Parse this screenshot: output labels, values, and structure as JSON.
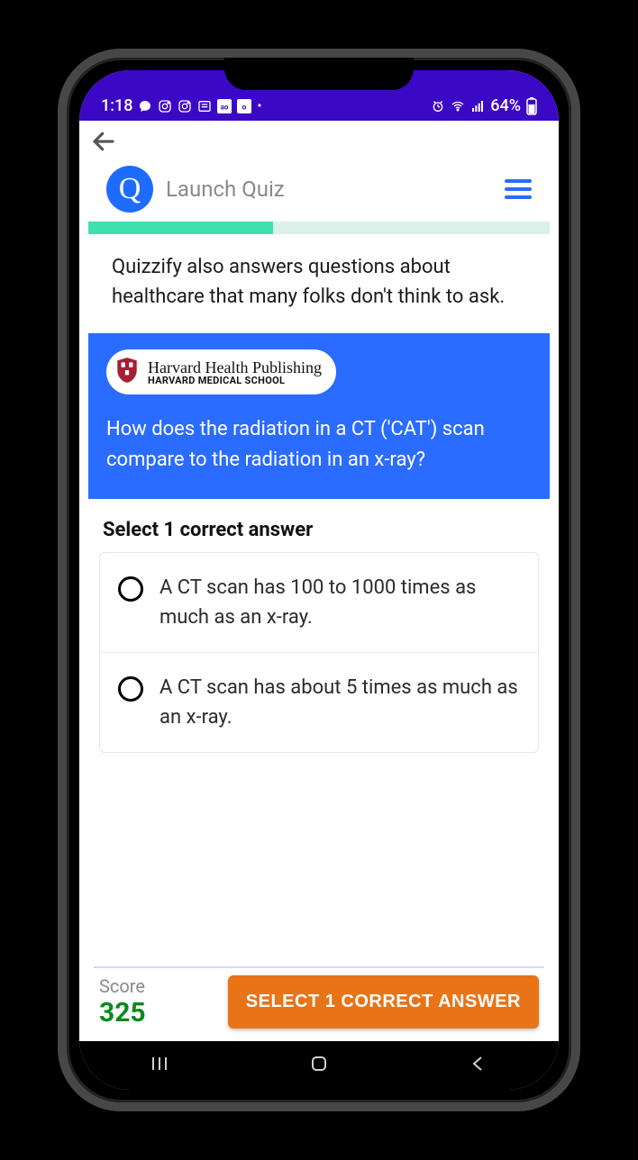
{
  "status": {
    "time": "1:18",
    "battery": "64%"
  },
  "header": {
    "title": "Launch Quiz"
  },
  "progress": {
    "percent": 40
  },
  "intro_text": "Quizzify also answers questions about healthcare that many folks don't think to ask.",
  "badge": {
    "line1": "Harvard Health Publishing",
    "line2": "HARVARD MEDICAL SCHOOL"
  },
  "question_text": "How does the radiation in a CT ('CAT') scan compare to the radiation in an x-ray?",
  "select_heading": "Select 1 correct answer",
  "answers": [
    {
      "text": "A CT scan has 100 to 1000 times as much as an x-ray."
    },
    {
      "text": "A CT scan has about 5 times as much as an x-ray."
    }
  ],
  "footer": {
    "score_label": "Score",
    "score_value": "325",
    "cta": "SELECT 1 CORRECT ANSWER"
  },
  "colors": {
    "primary_blue": "#2a6cff",
    "status_purple": "#3b08c6",
    "teal": "#3fe0b0",
    "orange": "#e87417",
    "green": "#0a8a1e"
  }
}
